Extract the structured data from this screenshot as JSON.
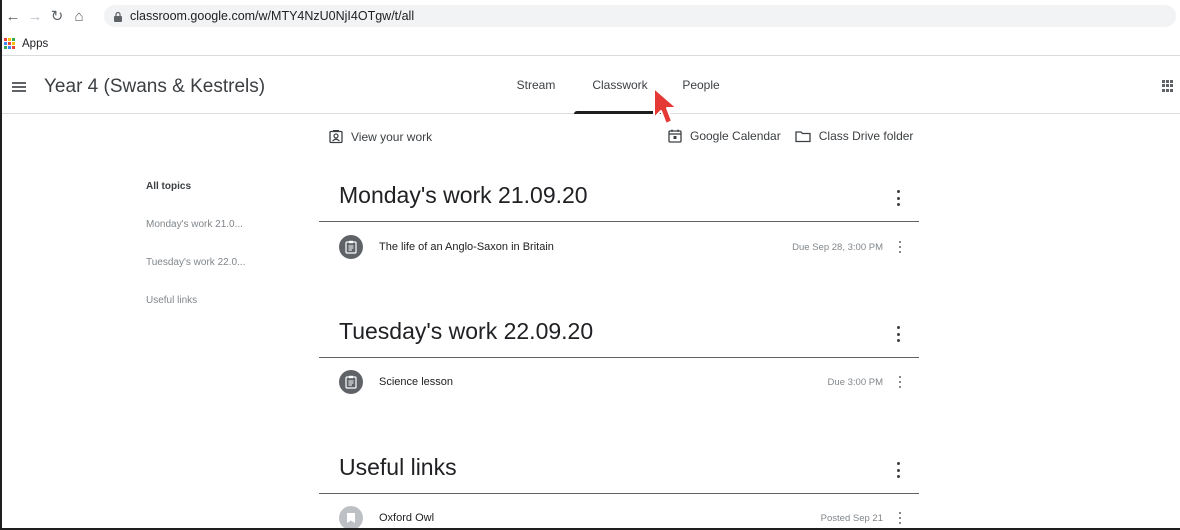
{
  "browser": {
    "url": "classroom.google.com/w/MTY4NzU0NjI4OTgw/t/all",
    "bookmarks_apps": "Apps"
  },
  "header": {
    "class_title": "Year 4 (Swans & Kestrels)",
    "tabs": [
      {
        "label": "Stream",
        "active": false
      },
      {
        "label": "Classwork",
        "active": true
      },
      {
        "label": "People",
        "active": false
      }
    ]
  },
  "toolbar": {
    "view_work": "View your work",
    "calendar": "Google Calendar",
    "drive": "Class Drive folder"
  },
  "sidebar": {
    "topics": [
      "All topics",
      "Monday's work 21.0...",
      "Tuesday's work 22.0...",
      "Useful links"
    ]
  },
  "sections": [
    {
      "title": "Monday's work 21.09.20",
      "items": [
        {
          "title": "The life of an Anglo-Saxon in Britain",
          "due": "Due Sep 28, 3:00 PM",
          "icon": "assignment-icon"
        }
      ]
    },
    {
      "title": "Tuesday's work 22.09.20",
      "items": [
        {
          "title": "Science lesson",
          "due": "Due 3:00 PM",
          "icon": "assignment-icon"
        }
      ]
    },
    {
      "title": "Useful links",
      "items": [
        {
          "title": "Oxford Owl",
          "due": "Posted Sep 21",
          "icon": "material-icon"
        }
      ]
    }
  ],
  "colors": {
    "text": "#3c4043",
    "muted": "#80868b",
    "icon_bg": "#5f6368",
    "cursor": "#e53935"
  }
}
